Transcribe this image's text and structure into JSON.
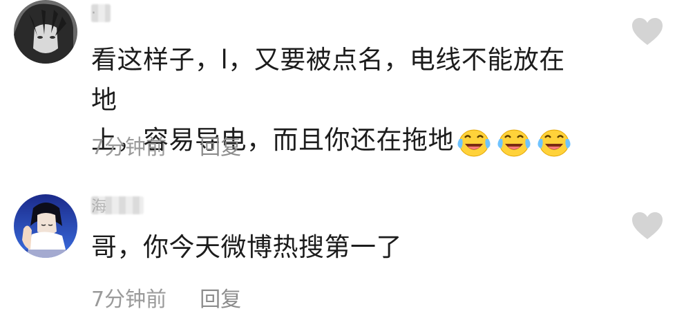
{
  "comments": [
    {
      "username": "·",
      "text_line1": "看这样子，l，又要被点名，电线不能放在地",
      "text_line2": "上，容易导电，而且你还在拖地",
      "emojis": [
        "crying-laughing-emoji",
        "crying-laughing-emoji",
        "crying-laughing-emoji"
      ],
      "timestamp": "7分钟前",
      "reply_label": "回复",
      "like_icon": "heart-icon"
    },
    {
      "username": "海",
      "text": "哥，你今天微博热搜第一了",
      "timestamp": "7分钟前",
      "reply_label": "回复",
      "like_icon": "heart-icon"
    }
  ],
  "colors": {
    "text": "#1c1c1c",
    "meta": "#9a9a9a",
    "heart": "#d4d4d4",
    "background": "#ffffff"
  }
}
